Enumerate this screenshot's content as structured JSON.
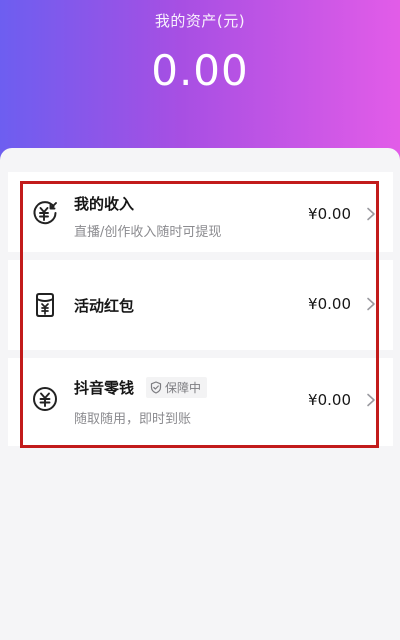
{
  "header": {
    "title": "我的资产(元)",
    "amount": "0.00"
  },
  "rows": [
    {
      "title": "我的收入",
      "subtitle": "直播/创作收入随时可提现",
      "amount": "¥0.00",
      "icon": "income-yuan-icon"
    },
    {
      "title": "活动红包",
      "amount": "¥0.00",
      "icon": "red-packet-icon"
    },
    {
      "title": "抖音零钱",
      "badge": "保障中",
      "subtitle": "随取随用，即时到账",
      "amount": "¥0.00",
      "icon": "wallet-yuan-icon"
    }
  ],
  "colors": {
    "gradient_start": "#6d5ef0",
    "gradient_end": "#e25ce8",
    "highlight_border": "#c21b1b"
  }
}
